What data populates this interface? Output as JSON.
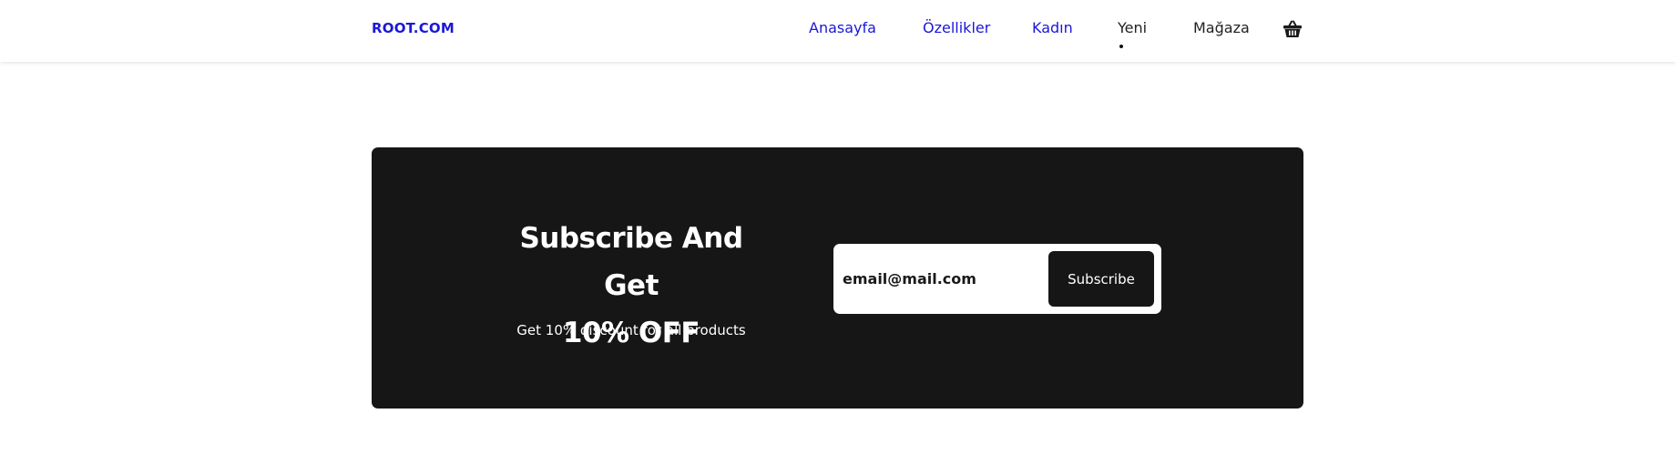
{
  "header": {
    "logo": "ROOT.COM",
    "nav": [
      {
        "label": "Anasayfa",
        "style": "link"
      },
      {
        "label": "Özellikler",
        "style": "link"
      },
      {
        "label": "Kadın",
        "style": "link"
      },
      {
        "label": "Yeni",
        "style": "plain",
        "active": true
      },
      {
        "label": "Mağaza",
        "style": "plain"
      }
    ],
    "cart_icon": "shopping-basket-icon"
  },
  "subscribe": {
    "heading_line1": "Subscribe And Get",
    "heading_line2": "10% OFF",
    "subtext": "Get 10% discount for all products",
    "email_placeholder": "email@mail.com",
    "button_label": "Subscribe"
  },
  "colors": {
    "link_blue": "#1b17d9",
    "banner_dark": "#161616",
    "text_dark": "#222222",
    "white": "#ffffff"
  }
}
